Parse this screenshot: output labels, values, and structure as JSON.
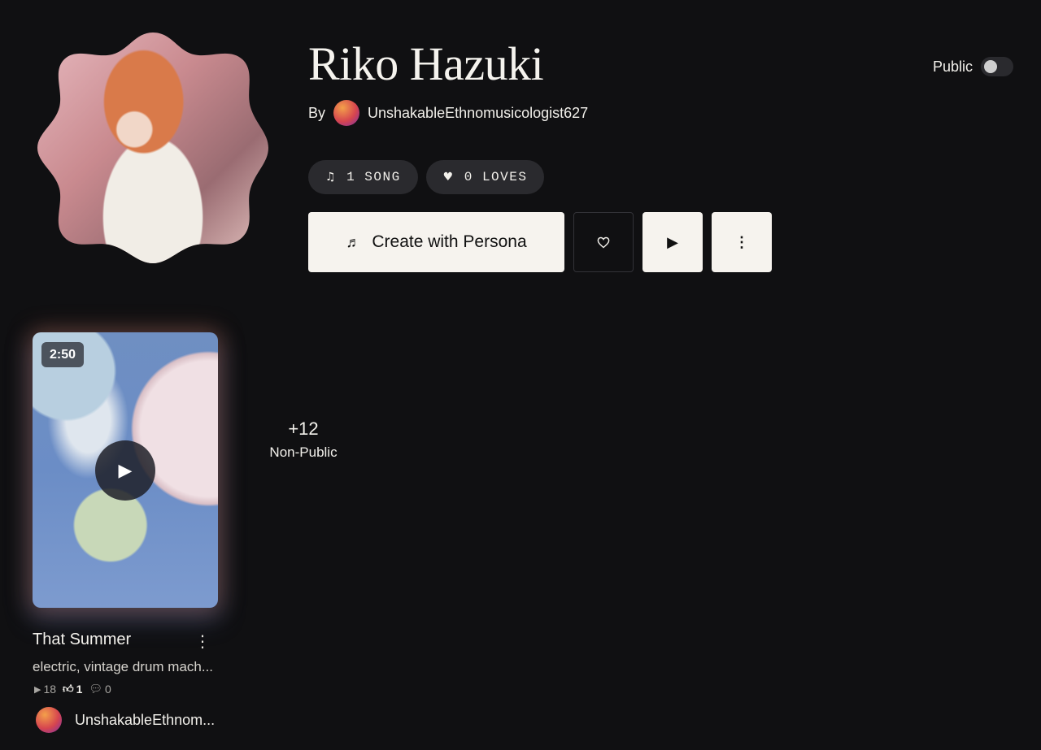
{
  "persona": {
    "name": "Riko Hazuki",
    "by_label": "By",
    "creator": "UnshakableEthnomusicologist627",
    "visibility_label": "Public"
  },
  "stats": {
    "songs": "1 SONG",
    "loves": "0 LOVES"
  },
  "actions": {
    "create_label": "Create with Persona"
  },
  "icons": {
    "music_note": "music-note-icon",
    "heart": "heart-icon",
    "play": "play-icon",
    "more": "more-vertical-icon",
    "music_plus": "music-plus-icon",
    "comment": "comment-icon",
    "thumbs_up": "thumbs-up-icon"
  },
  "non_public": {
    "count": "+12",
    "label": "Non-Public"
  },
  "song": {
    "duration": "2:50",
    "title": "That Summer",
    "description": "electric, vintage drum mach...",
    "plays": "18",
    "likes": "1",
    "comments": "0",
    "author": "UnshakableEthnom..."
  },
  "colors": {
    "background": "#101012",
    "button_light": "#f6f3ee",
    "pill": "#2a2a2e"
  }
}
